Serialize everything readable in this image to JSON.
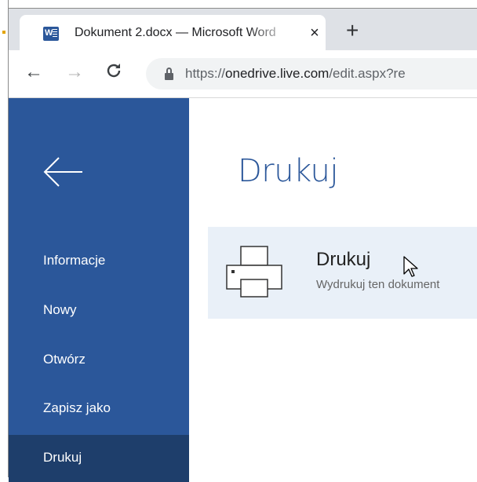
{
  "browser": {
    "tab": {
      "title": "Dokument 2.docx — Microsoft Word",
      "close": "×",
      "icon": "word-icon",
      "icon_letter": "W"
    },
    "new_tab": "+",
    "nav": {
      "back": "←",
      "forward": "→",
      "reload": "C"
    },
    "url": {
      "scheme": "https://",
      "domain": "onedrive.live.com",
      "path": "/edit.aspx?re"
    }
  },
  "sidebar": {
    "back_icon": "back-arrow-icon",
    "items": [
      {
        "label": "Informacje",
        "active": false
      },
      {
        "label": "Nowy",
        "active": false
      },
      {
        "label": "Otwórz",
        "active": false
      },
      {
        "label": "Zapisz jako",
        "active": false
      },
      {
        "label": "Drukuj",
        "active": true
      }
    ]
  },
  "main": {
    "title": "Drukuj",
    "print_option": {
      "name": "Drukuj",
      "description": "Wydrukuj ten dokument",
      "icon": "printer-icon"
    }
  },
  "colors": {
    "accent": "#2b579a",
    "sidebar_active": "#1e3e6b",
    "card_bg": "#e9f0f8"
  }
}
